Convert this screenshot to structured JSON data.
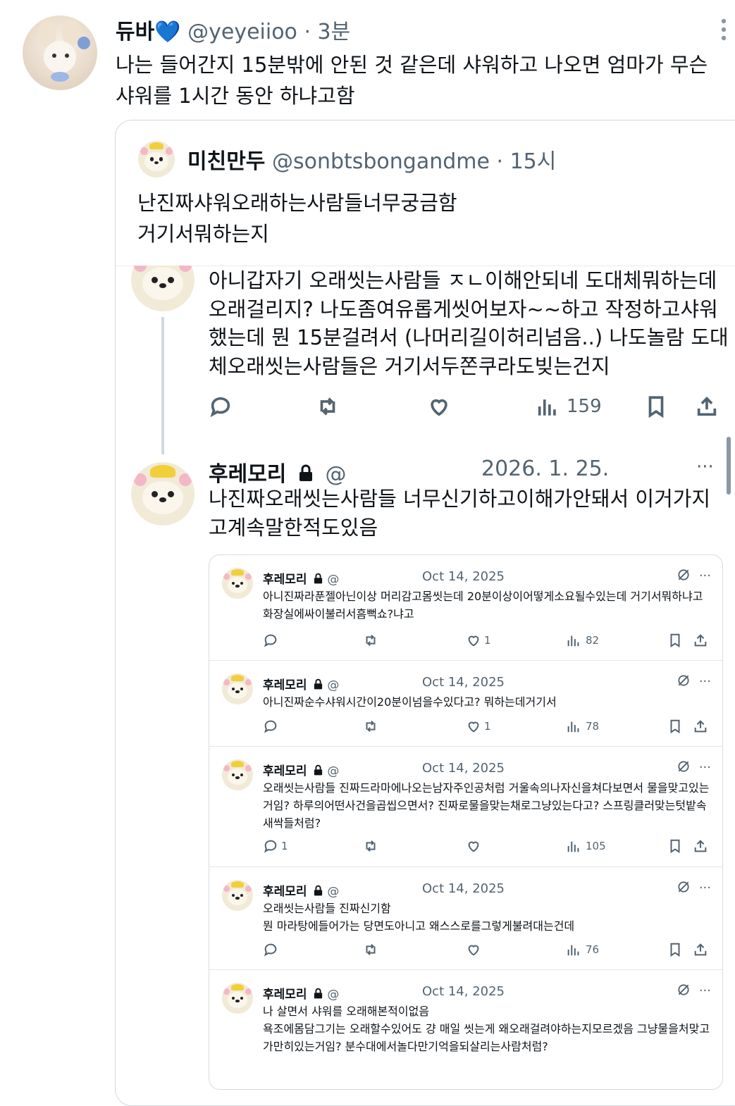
{
  "main_tweet": {
    "display_name": "듀바💙",
    "handle": "@yeyeiioo",
    "time": "· 3분",
    "text": "나는 들어간지 15분밖에 안된 것 같은데 샤워하고 나오면 엄마가 무슨 샤워를 1시간 동안 하냐고함"
  },
  "quoted_tweet": {
    "display_name": "미친만두",
    "handle": "@sonbtsbongandme",
    "time": "· 15시",
    "text_line1": "난진짜샤워오래하는사람들너무궁금함",
    "text_line2": "거기서뭐하는지"
  },
  "thread_tweet": {
    "text": "아니갑자기 오래씻는사람들 ㅈㄴ이해안되네 도대체뭐하는데오래걸리지? 나도좀여유롭게씻어보자~~하고 작정하고샤워했는데 뭔 15분걸려서 (나머리길이허리넘음..) 나도놀람 도대체오래씻는사람들은 거기서두쫀쿠라도빚는건지",
    "views": "159"
  },
  "reply_tweet": {
    "display_name": "후레모리",
    "handle": "@",
    "date": "2026. 1. 25.",
    "more": "···",
    "text": "나진짜오래씻는사람들 너무신기하고이해가안돼서 이거가지고계속말한적도있음"
  },
  "embedded_posts": [
    {
      "name": "후레모리",
      "handle": "@",
      "date": "Oct 14, 2025",
      "text": "아니진짜라푼젤아닌이상 머리감고몸씻는데 20분이상이어떻게소요될수있는데 거기서뭐하냐고 화장실에싸이불러서흠뻑쇼?냐고",
      "replies": "",
      "likes": "1",
      "views": "82"
    },
    {
      "name": "후레모리",
      "handle": "@",
      "date": "Oct 14, 2025",
      "text": "아니진짜순수샤워시간이20분이넘을수있다고? 뭐하는데거기서",
      "replies": "",
      "likes": "1",
      "views": "78"
    },
    {
      "name": "후레모리",
      "handle": "@",
      "date": "Oct 14, 2025",
      "text": "오래씻는사람들 진짜드라마에나오는남자주인공처럼 거울속의나자신을쳐다보면서 물을맞고있는거임? 하루의어떤사건을곱씹으면서? 진짜로물을맞는채로그냥있는다고? 스프링클러맞는텃밭속새싹들처럼?",
      "replies": "1",
      "likes": "",
      "views": "105"
    },
    {
      "name": "후레모리",
      "handle": "@",
      "date": "Oct 14, 2025",
      "text": "오래씻는사람들 진짜신기함\n뭔 마라탕에들어가는 당면도아니고 왜스스로를그렇게불려대는건데",
      "replies": "",
      "likes": "",
      "views": "76"
    },
    {
      "name": "후레모리",
      "handle": "@",
      "date": "Oct 14, 2025",
      "text": "나 살면서 샤워를 오래해본적이없음\n욕조에몸담그기는 오래할수있어도 걍 매일 씻는게 왜오래걸려야하는지모르겠음 그냥물을처맞고 가만히있는거임? 분수대에서놀다만기억을되살리는사람처럼?",
      "replies": "",
      "likes": "",
      "views": ""
    }
  ],
  "icons": {
    "more": "more-dots-icon",
    "lock": "lock-icon",
    "reply": "reply-icon",
    "retweet": "retweet-icon",
    "like": "heart-icon",
    "views": "views-icon",
    "bookmark": "bookmark-icon",
    "share": "share-icon",
    "grok": "grok-icon"
  }
}
